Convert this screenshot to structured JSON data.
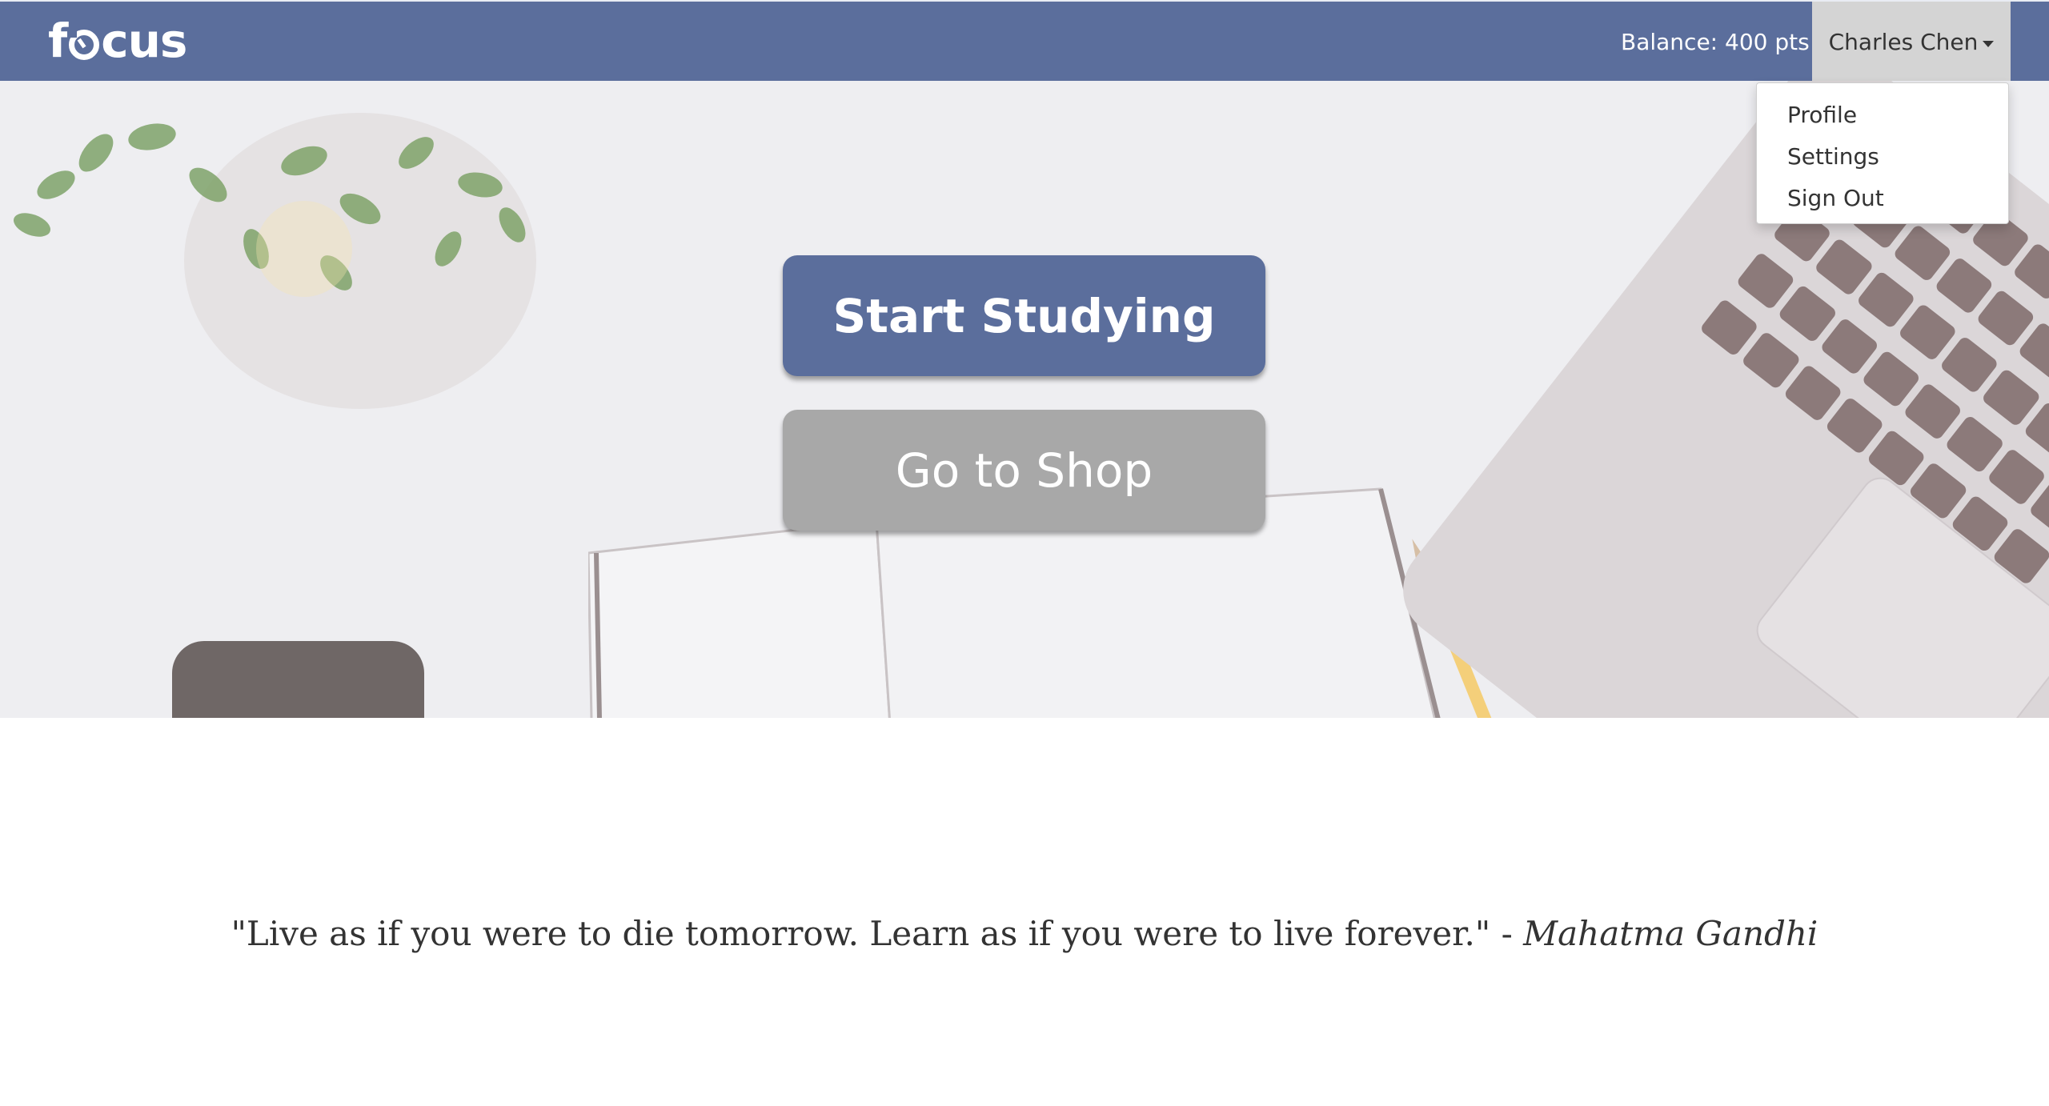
{
  "navbar": {
    "brand_prefix": "f",
    "brand_suffix": "cus",
    "balance_text": "Balance: 400 pts",
    "user_name": "Charles Chen",
    "accent_color": "#5b6e9c"
  },
  "user_menu": {
    "items": [
      {
        "label": "Profile"
      },
      {
        "label": "Settings"
      },
      {
        "label": "Sign Out"
      }
    ]
  },
  "hero": {
    "primary_button": "Start Studying",
    "secondary_button": "Go to Shop"
  },
  "quote": {
    "text": "\"Live as if you were to die tomorrow. Learn as if you were to live forever.\" -",
    "author": "Mahatma Gandhi"
  },
  "icons": {
    "caret": "caret-down-icon",
    "logo": "focus-logo"
  }
}
